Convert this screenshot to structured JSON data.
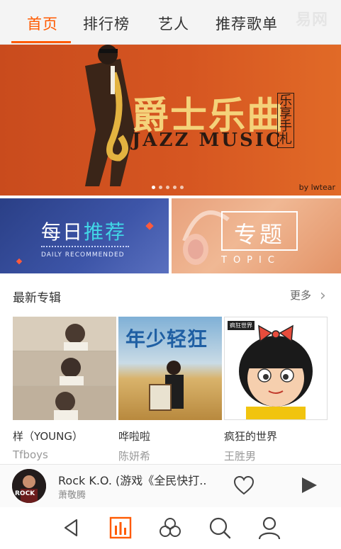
{
  "tabs": [
    {
      "label": "首页",
      "active": true
    },
    {
      "label": "排行榜",
      "active": false
    },
    {
      "label": "艺人",
      "active": false
    },
    {
      "label": "推荐歌单",
      "active": false
    }
  ],
  "watermark": "易网",
  "banner": {
    "title": "爵士乐曲",
    "subtitle": "JAZZ MUSIC",
    "vertical_text": "乐享手札",
    "credit": "by lwtear",
    "dot_count": 5,
    "active_dot": 0
  },
  "promos": {
    "daily": {
      "title_plain": "每日",
      "title_highlight": "推荐",
      "subtitle": "DAILY RECOMMENDED"
    },
    "topic": {
      "title": "专题",
      "subtitle": "TOPIC"
    }
  },
  "section": {
    "title": "最新专辑",
    "more": "更多"
  },
  "albums": [
    {
      "title": "样（YOUNG）",
      "artist": "Tfboys"
    },
    {
      "title": "哗啦啦",
      "artist": "陈妍希",
      "cover_text": "年少轻狂"
    },
    {
      "title": "疯狂的世界",
      "artist": "王胜男",
      "cover_text": "疯狂世界"
    }
  ],
  "player": {
    "title": "Rock K.O. (游戏《全民快打..",
    "artist": "萧敬腾",
    "avatar_text": "ROCK"
  },
  "nav": {
    "items": [
      "back",
      "charts",
      "discover",
      "search",
      "profile"
    ],
    "active": "charts"
  },
  "colors": {
    "accent": "#ff5a00",
    "highlight": "#41d6e6"
  }
}
